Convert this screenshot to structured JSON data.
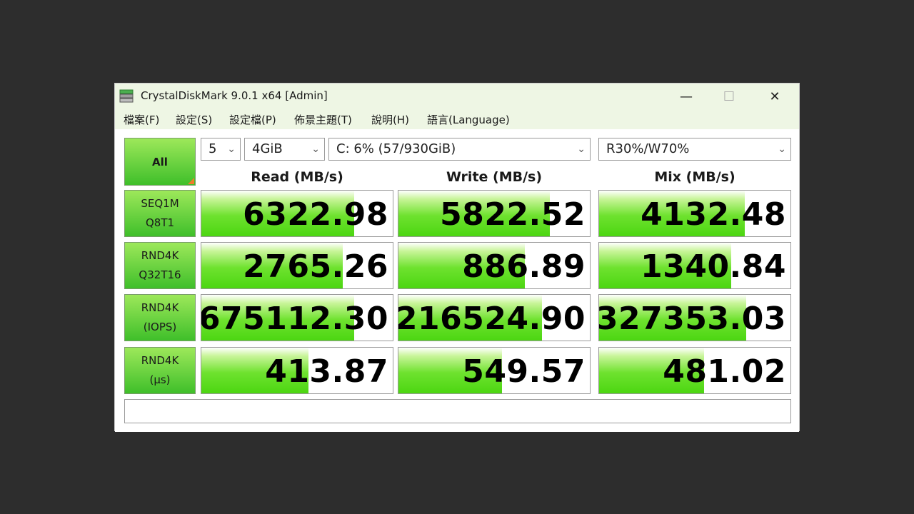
{
  "window": {
    "title": "CrystalDiskMark 9.0.1 x64 [Admin]",
    "minimize": "—",
    "maximize": "☐",
    "close": "✕"
  },
  "menu": [
    "檔案(F)",
    "設定(S)",
    "設定檔(P)",
    "佈景主題(T)",
    "說明(H)",
    "語言(Language)"
  ],
  "controls": {
    "all_label": "All",
    "count": "5",
    "size": "4GiB",
    "drive": "C: 6% (57/930GiB)",
    "mix": "R30%/W70%"
  },
  "headers": {
    "read": "Read (MB/s)",
    "write": "Write (MB/s)",
    "mix": "Mix (MB/s)"
  },
  "rows": [
    {
      "line1": "SEQ1M",
      "line2": "Q8T1",
      "read": "6322.98",
      "write": "5822.52",
      "mix": "4132.48",
      "read_fill": 0.8,
      "write_fill": 0.79,
      "mix_fill": 0.76
    },
    {
      "line1": "RND4K",
      "line2": "Q32T16",
      "read": "2765.26",
      "write": "886.89",
      "mix": "1340.84",
      "read_fill": 0.74,
      "write_fill": 0.66,
      "mix_fill": 0.69
    },
    {
      "line1": "RND4K",
      "line2": "(IOPS)",
      "read": "675112.30",
      "write": "216524.90",
      "mix": "327353.03",
      "read_fill": 0.8,
      "write_fill": 0.75,
      "mix_fill": 0.77
    },
    {
      "line1": "RND4K",
      "line2": "(μs)",
      "read": "413.87",
      "write": "549.57",
      "mix": "481.02",
      "read_fill": 0.56,
      "write_fill": 0.54,
      "mix_fill": 0.55
    }
  ],
  "comment": ""
}
